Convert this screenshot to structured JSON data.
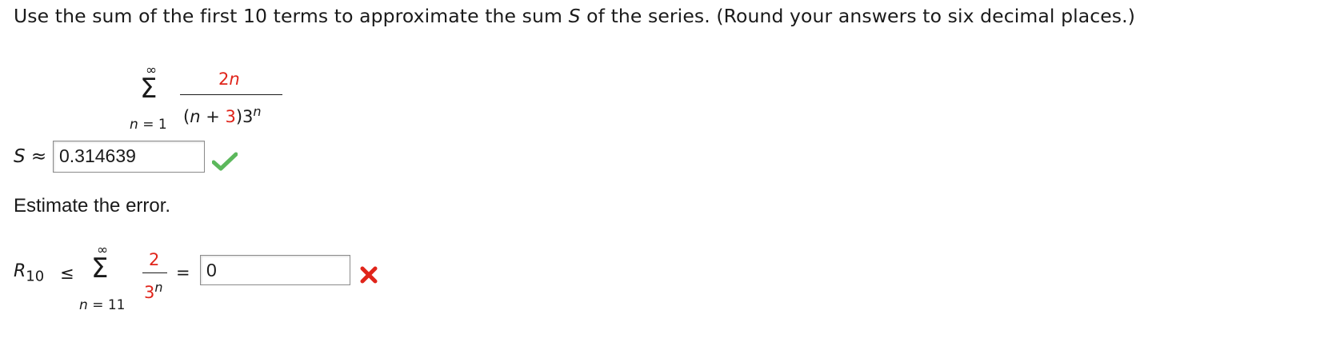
{
  "question": {
    "text_part1": "Use the sum of the first 10 terms to approximate the sum ",
    "var_s": "S",
    "text_part2": " of the series. (Round your answers to six decimal places.)"
  },
  "series": {
    "upper_limit": "∞",
    "sigma": "Σ",
    "lower_index": "n",
    "lower_eq": "=",
    "lower_value": "1",
    "numerator_coef": "2",
    "numerator_var": "n",
    "denominator_open": "(",
    "denominator_var": "n",
    "denominator_plus": " + ",
    "denominator_const": "3",
    "denominator_close": ")",
    "denominator_base": "3",
    "denominator_exp": "n"
  },
  "sum_answer": {
    "label_var": "S",
    "approx": "≈",
    "value": "0.314639",
    "status": "correct",
    "status_color": "#5cb85c"
  },
  "error_section": {
    "heading": "Estimate the error."
  },
  "remainder": {
    "r_var": "R",
    "r_sub": "10",
    "leq": "≤",
    "upper_limit": "∞",
    "sigma": "Σ",
    "lower_index": "n",
    "lower_eq": "=",
    "lower_value": "11",
    "numerator": "2",
    "denominator_base": "3",
    "denominator_exp": "n",
    "equals": "=",
    "value": "0",
    "status": "incorrect",
    "status_color": "#e0241a"
  }
}
